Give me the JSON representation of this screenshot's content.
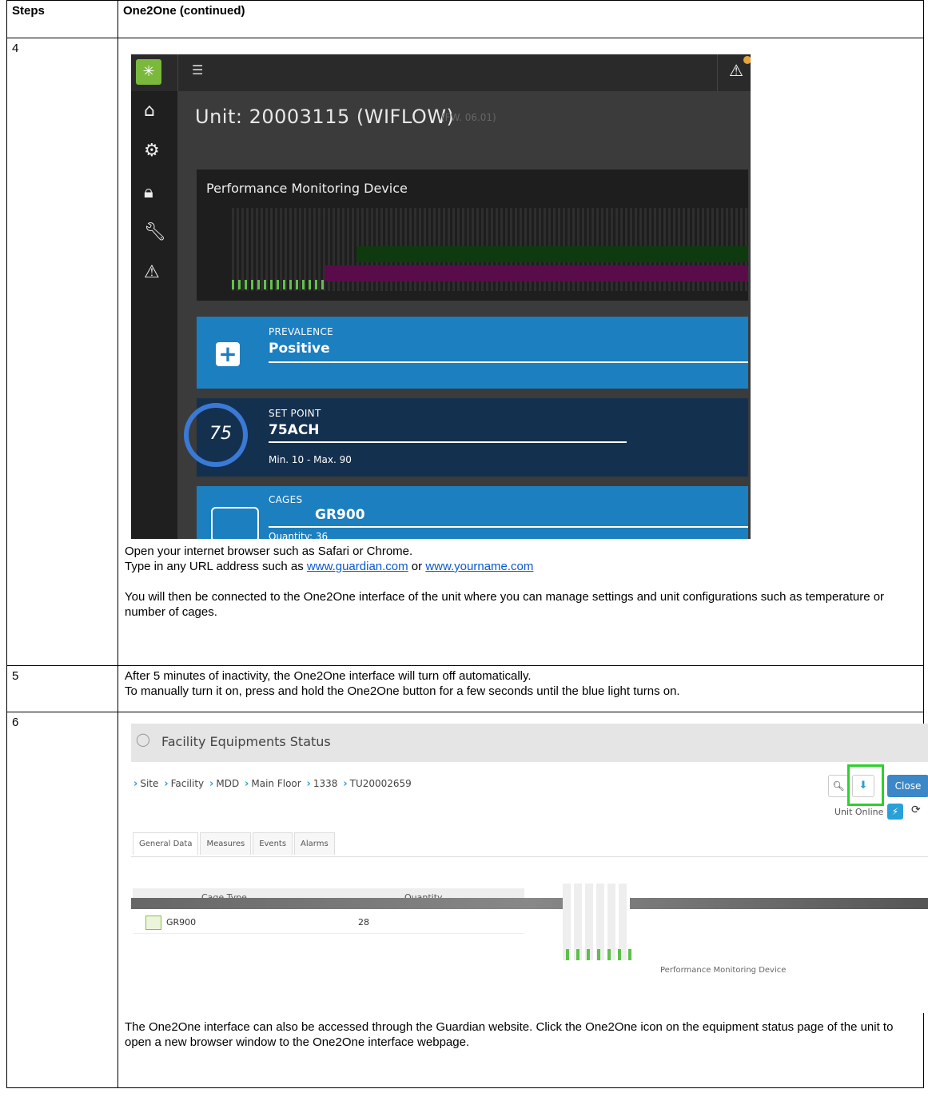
{
  "header": {
    "col1": "Steps",
    "col2": "One2One (continued)"
  },
  "rows": [
    {
      "step": "4",
      "screenshot": {
        "menu_icon": "hamburger-icon",
        "unit_title": "Unit: 20003115 (WIFLOW)",
        "firmware": "(FW. 06.01)",
        "perf_title": "Performance Monitoring Device",
        "prevalence_label": "PREVALENCE",
        "prevalence_value": "Positive",
        "setpoint_label": "SET POINT",
        "setpoint_value": "75ACH",
        "setpoint_gauge": "75",
        "setpoint_range": "Min. 10 - Max. 90",
        "cages_label": "CAGES",
        "cages_value": "GR900",
        "cages_quantity": "Quantity: 36",
        "accent": "#1c7fc0",
        "logo_color": "#7ab93b"
      },
      "text1": "Open your internet browser such as Safari or Chrome.",
      "text2_prefix": "Type in any URL address such as ",
      "link1": "www.guardian.com",
      "text2_mid": " or ",
      "link2": "www.yourname.com",
      "text3": "You will then be connected to the One2One interface of the unit where you can manage settings and unit configurations such as temperature or number of cages."
    },
    {
      "step": "5",
      "text1": "After 5 minutes of inactivity, the One2One interface will turn off automatically.",
      "text2": "To manually turn it on, press and hold the One2One button for a few seconds until the blue light turns on."
    },
    {
      "step": "6",
      "screenshot": {
        "title": "Facility Equipments Status",
        "breadcrumbs": [
          "Site",
          "Facility",
          "MDD",
          "Main Floor",
          "1338",
          "TU20002659"
        ],
        "close_label": "Close",
        "unit_online": "Unit Online",
        "tabs": [
          "General Data",
          "Measures",
          "Events",
          "Alarms"
        ],
        "col_cage_type": "Cage Type",
        "col_quantity": "Quantity",
        "cage_type": "GR900",
        "quantity": "28",
        "perf_caption": "Performance Monitoring Device",
        "highlight_color": "#2cd12c"
      },
      "text1": "The One2One interface can also be accessed through the Guardian website. Click the One2One icon on the equipment status page of the unit to open a new browser window to the One2One interface webpage."
    }
  ]
}
